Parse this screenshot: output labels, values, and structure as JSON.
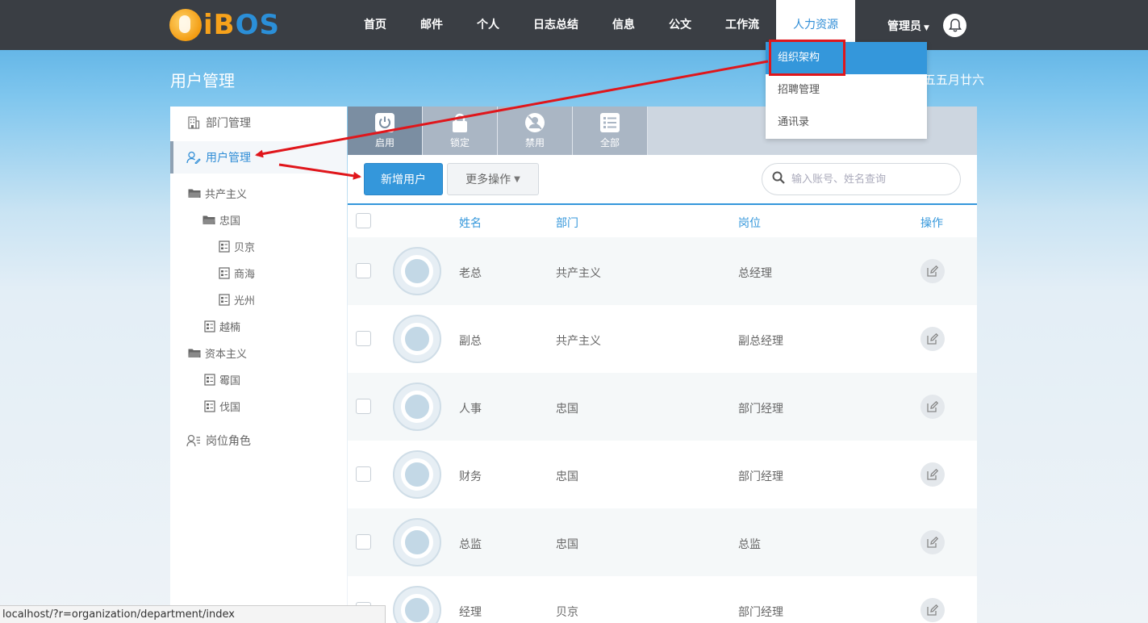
{
  "brand": {
    "logo_letters_1": "iB",
    "logo_letters_2": "OS"
  },
  "nav": {
    "items": [
      {
        "label": "首页"
      },
      {
        "label": "邮件"
      },
      {
        "label": "个人"
      },
      {
        "label": "日志总结"
      },
      {
        "label": "信息"
      },
      {
        "label": "公文"
      },
      {
        "label": "工作流"
      },
      {
        "label": "人力资源"
      }
    ],
    "active": "人力资源",
    "user_label": "管理员",
    "bell_icon": "bell-icon"
  },
  "dropdown": {
    "items": [
      {
        "label": "组织架构"
      },
      {
        "label": "招聘管理"
      },
      {
        "label": "通讯录"
      }
    ],
    "active": "组织架构"
  },
  "page": {
    "title": "用户管理",
    "date_text": "五五月廿六"
  },
  "sidebar": {
    "items": [
      {
        "label": "部门管理",
        "icon": "building-icon"
      },
      {
        "label": "用户管理",
        "icon": "user-icon"
      },
      {
        "label": "岗位角色",
        "icon": "role-icon"
      }
    ],
    "active": "用户管理",
    "tree": [
      {
        "label": "共产主义",
        "type": "folder"
      },
      {
        "label": "忠国",
        "type": "folder"
      },
      {
        "label": "贝京",
        "type": "doc"
      },
      {
        "label": "商海",
        "type": "doc"
      },
      {
        "label": "光州",
        "type": "doc"
      },
      {
        "label": "越楠",
        "type": "doc"
      },
      {
        "label": "资本主义",
        "type": "folder"
      },
      {
        "label": "霉国",
        "type": "doc"
      },
      {
        "label": "伐国",
        "type": "doc"
      }
    ]
  },
  "tabs": [
    {
      "label": "启用",
      "icon": "power-icon"
    },
    {
      "label": "锁定",
      "icon": "lock-icon"
    },
    {
      "label": "禁用",
      "icon": "disabled-icon"
    },
    {
      "label": "全部",
      "icon": "list-icon"
    }
  ],
  "active_tab": "启用",
  "toolbar": {
    "add_user_label": "新增用户",
    "more_actions_label": "更多操作",
    "search_placeholder": "输入账号、姓名查询"
  },
  "table": {
    "columns": [
      "姓名",
      "部门",
      "岗位",
      "操作"
    ],
    "rows": [
      {
        "name": "老总",
        "dept": "共产主义",
        "position": "总经理"
      },
      {
        "name": "副总",
        "dept": "共产主义",
        "position": "副总经理"
      },
      {
        "name": "人事",
        "dept": "忠国",
        "position": "部门经理"
      },
      {
        "name": "财务",
        "dept": "忠国",
        "position": "部门经理"
      },
      {
        "name": "总监",
        "dept": "忠国",
        "position": "总监"
      },
      {
        "name": "经理",
        "dept": "贝京",
        "position": "部门经理"
      }
    ]
  },
  "statusbar": {
    "url": "localhost/?r=organization/department/index"
  },
  "colors": {
    "accent": "#3497db",
    "topbar": "#3a3e44",
    "highlight": "#e0161b"
  }
}
